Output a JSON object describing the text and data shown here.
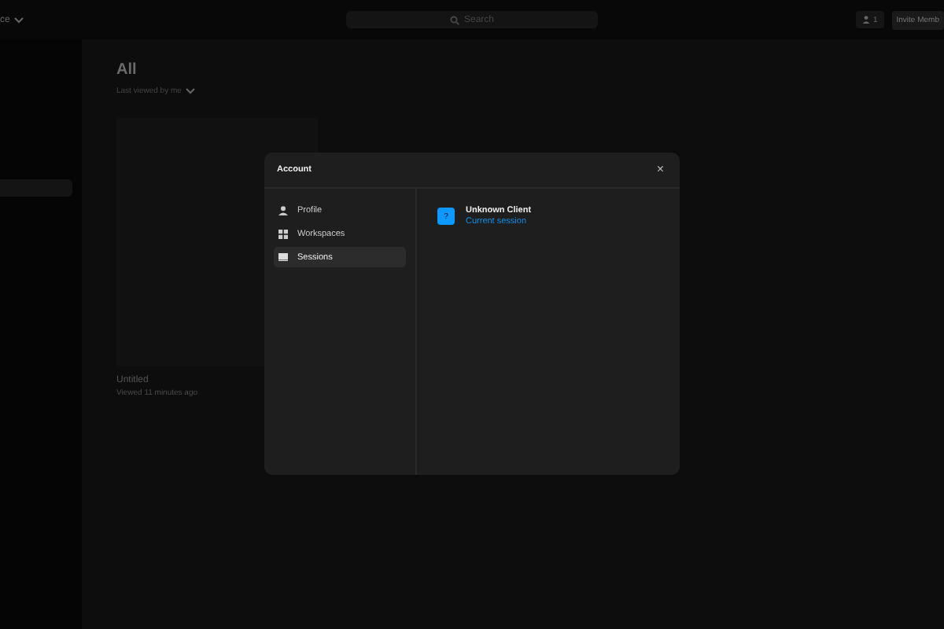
{
  "topbar": {
    "workspace": "ce",
    "search": {
      "placeholder": "Search"
    },
    "members_count": "1",
    "invite_button": "Invite Memb"
  },
  "main": {
    "title": "All",
    "sort": "Last viewed by me",
    "files": [
      {
        "name": "Untitled",
        "meta": "Viewed 11 minutes ago"
      }
    ]
  },
  "dialog": {
    "title": "Account",
    "close": "×",
    "nav": [
      {
        "label": "Profile",
        "kind": "profile",
        "selected": false
      },
      {
        "label": "Workspaces",
        "kind": "workspaces",
        "selected": false
      },
      {
        "label": "Sessions",
        "kind": "sessions",
        "selected": true
      }
    ],
    "sessions": [
      {
        "icon": "?",
        "name": "Unknown Client",
        "status": "Current session"
      }
    ]
  }
}
